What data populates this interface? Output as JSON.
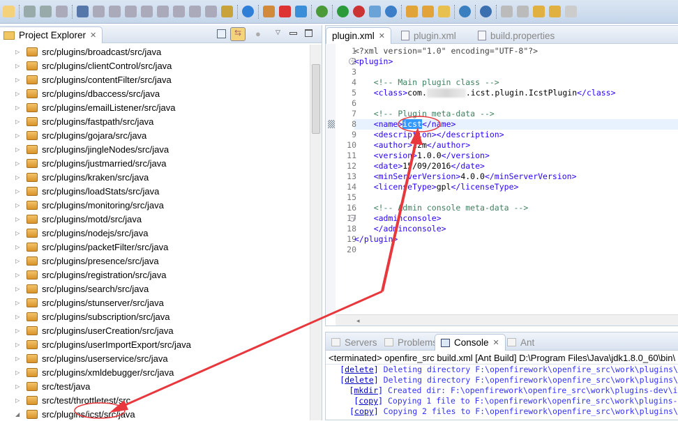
{
  "toolbar": {
    "icons": [
      "new-icon",
      "save-icon",
      "save-all-icon",
      "print-icon",
      "skip-breakpoints-icon",
      "resume-icon",
      "suspend-icon",
      "terminate-icon",
      "disconnect-icon",
      "step-into-icon",
      "step-over-icon",
      "step-return-icon",
      "drop-to-frame-icon",
      "use-step-filters-icon",
      "browser-icon",
      "tomcat-start-icon",
      "tomcat-stop-icon",
      "tomcat-restart-icon",
      "debug-icon",
      "run-icon",
      "run-external-icon",
      "new-server-icon",
      "new-service-icon",
      "open-project-icon",
      "open-folder-icon",
      "brush-icon",
      "globe-icon",
      "run-ant-icon",
      "next-annotation-icon",
      "prev-annotation-icon",
      "last-edit-icon",
      "back-icon",
      "forward-icon"
    ]
  },
  "project_explorer": {
    "title": "Project Explorer",
    "items": [
      {
        "label": "src/plugins/broadcast/src/java",
        "expanded": false
      },
      {
        "label": "src/plugins/clientControl/src/java",
        "expanded": false
      },
      {
        "label": "src/plugins/contentFilter/src/java",
        "expanded": false
      },
      {
        "label": "src/plugins/dbaccess/src/java",
        "expanded": false
      },
      {
        "label": "src/plugins/emailListener/src/java",
        "expanded": false
      },
      {
        "label": "src/plugins/fastpath/src/java",
        "expanded": false
      },
      {
        "label": "src/plugins/gojara/src/java",
        "expanded": false
      },
      {
        "label": "src/plugins/jingleNodes/src/java",
        "expanded": false
      },
      {
        "label": "src/plugins/justmarried/src/java",
        "expanded": false
      },
      {
        "label": "src/plugins/kraken/src/java",
        "expanded": false
      },
      {
        "label": "src/plugins/loadStats/src/java",
        "expanded": false
      },
      {
        "label": "src/plugins/monitoring/src/java",
        "expanded": false
      },
      {
        "label": "src/plugins/motd/src/java",
        "expanded": false
      },
      {
        "label": "src/plugins/nodejs/src/java",
        "expanded": false
      },
      {
        "label": "src/plugins/packetFilter/src/java",
        "expanded": false
      },
      {
        "label": "src/plugins/presence/src/java",
        "expanded": false
      },
      {
        "label": "src/plugins/registration/src/java",
        "expanded": false
      },
      {
        "label": "src/plugins/search/src/java",
        "expanded": false
      },
      {
        "label": "src/plugins/stunserver/src/java",
        "expanded": false
      },
      {
        "label": "src/plugins/subscription/src/java",
        "expanded": false
      },
      {
        "label": "src/plugins/userCreation/src/java",
        "expanded": false
      },
      {
        "label": "src/plugins/userImportExport/src/java",
        "expanded": false
      },
      {
        "label": "src/plugins/userservice/src/java",
        "expanded": false
      },
      {
        "label": "src/plugins/xmldebugger/src/java",
        "expanded": false
      },
      {
        "label": "src/test/java",
        "expanded": false
      },
      {
        "label": "src/test/throttletest/src",
        "expanded": false
      },
      {
        "label": "src/plugins/icst/src/java",
        "expanded": true
      }
    ]
  },
  "editor": {
    "tabs": [
      {
        "label": "plugin.xml",
        "active": true
      },
      {
        "label": "plugin.xml",
        "active": false
      },
      {
        "label": "build.properties",
        "active": false
      }
    ],
    "lines": [
      {
        "n": "1",
        "html": "<span class='pi'>&lt;?xml version=\"1.0\" encoding=\"UTF-8\"?&gt;</span>"
      },
      {
        "n": "2",
        "html": "<span class='t'>&lt;plugin&gt;</span>"
      },
      {
        "n": "3",
        "html": ""
      },
      {
        "n": "4",
        "html": "    <span class='c'>&lt;!-- Main plugin class --&gt;</span>"
      },
      {
        "n": "5",
        "html": "    <span class='t'>&lt;class&gt;</span>com.<span class='blur'></span>.icst.plugin.IcstPlugin<span class='t'>&lt;/class&gt;</span>"
      },
      {
        "n": "6",
        "html": ""
      },
      {
        "n": "7",
        "html": "    <span class='c'>&lt;!-- Plugin meta-data --&gt;</span>"
      },
      {
        "n": "8",
        "html": "    <span class='t'>&lt;name&gt;</span><span class='sel'>icst</span><span class='t'>&lt;/name&gt;</span>"
      },
      {
        "n": "9",
        "html": "    <span class='t'>&lt;description&gt;&lt;/description&gt;</span>"
      },
      {
        "n": "10",
        "html": "    <span class='t'>&lt;author&gt;</span>zzm<span class='t'>&lt;/author&gt;</span>"
      },
      {
        "n": "11",
        "html": "    <span class='t'>&lt;version&gt;</span>1.0.0<span class='t'>&lt;/version&gt;</span>"
      },
      {
        "n": "12",
        "html": "    <span class='t'>&lt;date&gt;</span>15/09/2016<span class='t'>&lt;/date&gt;</span>"
      },
      {
        "n": "13",
        "html": "    <span class='t'>&lt;minServerVersion&gt;</span>4.0.0<span class='t'>&lt;/minServerVersion&gt;</span>"
      },
      {
        "n": "14",
        "html": "    <span class='t'>&lt;licenseType&gt;</span>gpl<span class='t'>&lt;/licenseType&gt;</span>"
      },
      {
        "n": "15",
        "html": ""
      },
      {
        "n": "16",
        "html": "    <span class='c'>&lt;!-- Admin console meta-data --&gt;</span>"
      },
      {
        "n": "17",
        "html": "    <span class='t'>&lt;adminconsole&gt;</span>"
      },
      {
        "n": "18",
        "html": "    <span class='t'>&lt;/adminconsole&gt;</span>"
      },
      {
        "n": "19",
        "html": "<span class='t'>&lt;/plugin&gt;</span>"
      },
      {
        "n": "20",
        "html": ""
      }
    ],
    "current_line": "8"
  },
  "console": {
    "tabs": [
      {
        "label": "Servers"
      },
      {
        "label": "Problems"
      },
      {
        "label": "Console",
        "active": true
      },
      {
        "label": "Ant"
      }
    ],
    "header": "<terminated> openfire_src build.xml [Ant Build] D:\\Program Files\\Java\\jdk1.8.0_60\\bin\\",
    "lines": [
      {
        "task": "delete",
        "msg": "Deleting directory F:\\openfirework\\openfire_src\\work\\plugins\\"
      },
      {
        "task": "delete",
        "msg": "Deleting directory F:\\openfirework\\openfire_src\\work\\plugins\\"
      },
      {
        "task": "mkdir",
        "msg": "Created dir: F:\\openfirework\\openfire_src\\work\\plugins-dev\\i"
      },
      {
        "task": "copy",
        "msg": "Copying 1 file to F:\\openfirework\\openfire_src\\work\\plugins-"
      },
      {
        "task": "copy",
        "msg": "Copying 2 files to F:\\openfirework\\openfire_src\\work\\plugins\\"
      }
    ]
  },
  "colors": {
    "annotation": "#e8383d",
    "tag": "#2a00ff",
    "comment": "#3f7f5f",
    "selection": "#3399ff"
  }
}
